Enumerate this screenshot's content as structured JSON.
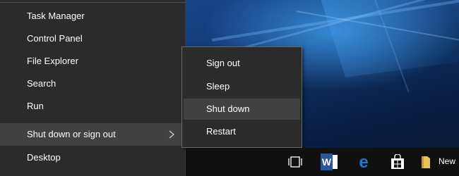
{
  "menu": {
    "items": [
      {
        "label": "Task Manager"
      },
      {
        "label": "Control Panel"
      },
      {
        "label": "File Explorer"
      },
      {
        "label": "Search"
      },
      {
        "label": "Run"
      },
      {
        "label": "Shut down or sign out"
      },
      {
        "label": "Desktop"
      }
    ]
  },
  "submenu": {
    "items": [
      {
        "label": "Sign out"
      },
      {
        "label": "Sleep"
      },
      {
        "label": "Shut down"
      },
      {
        "label": "Restart"
      }
    ]
  },
  "taskbar": {
    "items": [
      {
        "icon": "task-view-icon"
      },
      {
        "icon": "word-icon",
        "letter": "W"
      },
      {
        "icon": "edge-icon",
        "letter": "e"
      },
      {
        "icon": "store-icon"
      },
      {
        "icon": "folder-icon",
        "label": "New"
      }
    ]
  },
  "colors": {
    "menu_bg": "#2b2b2b",
    "menu_highlight": "#414141",
    "taskbar_bg": "#101010",
    "word_blue": "#2b579a",
    "edge_blue": "#1e7ad6",
    "folder_yellow": "#e8c25a"
  }
}
